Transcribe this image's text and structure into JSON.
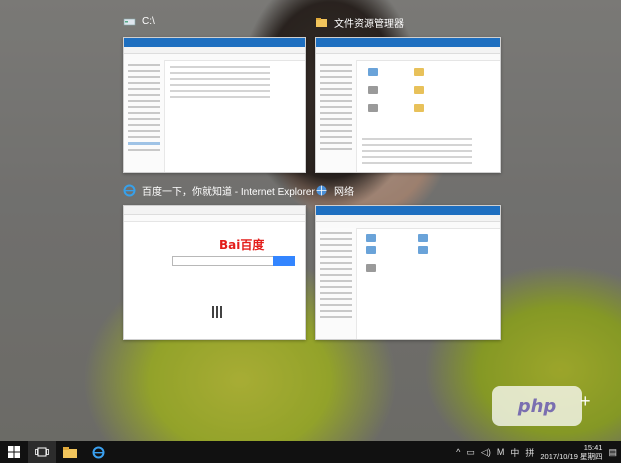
{
  "windows": [
    {
      "title": "C:\\",
      "icon": "drive-icon"
    },
    {
      "title": "文件资源管理器",
      "icon": "file-explorer-icon"
    },
    {
      "title": "百度一下，你就知道 - Internet Explorer",
      "icon": "ie-icon"
    },
    {
      "title": "网络",
      "icon": "network-icon"
    }
  ],
  "baidu": {
    "logo_left": "Bai",
    "logo_paw": "",
    "logo_right": "百度"
  },
  "watermark": "php",
  "new_desktop_symbol": "+",
  "taskbar": {
    "start_icon": "windows-start-icon",
    "task_view_icon": "task-view-icon",
    "explorer_icon": "folder-icon",
    "edge_icon": "edge-icon"
  },
  "tray": {
    "ime": "M",
    "ime_mode": "中",
    "language": "拼",
    "time": "15:41",
    "date": "2017/10/19 星期四"
  },
  "colors": {
    "accent": "#1e6fc0",
    "taskbar": "#111111"
  }
}
